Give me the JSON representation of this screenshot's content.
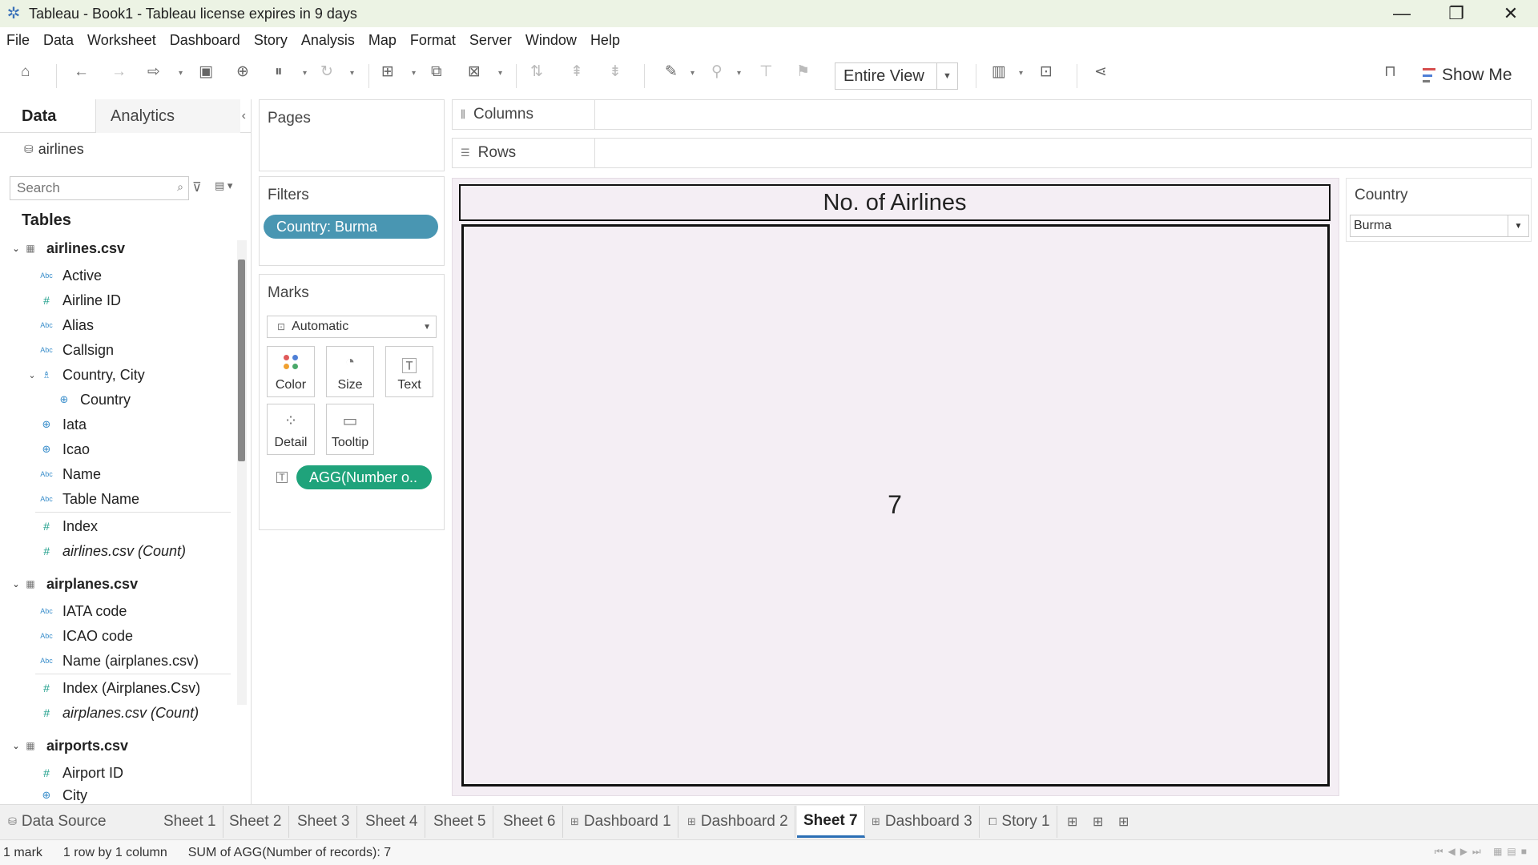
{
  "window": {
    "title": "Tableau - Book1 - Tableau license expires in 9 days",
    "controls": [
      "—",
      "❐",
      "✕"
    ]
  },
  "menu": [
    "File",
    "Data",
    "Worksheet",
    "Dashboard",
    "Story",
    "Analysis",
    "Map",
    "Format",
    "Server",
    "Window",
    "Help"
  ],
  "toolbar": {
    "view_mode": "Entire View",
    "show_me": "Show Me"
  },
  "datapane": {
    "tab_data": "Data",
    "tab_analytics": "Analytics",
    "datasource": "airlines",
    "search_placeholder": "Search",
    "tables_header": "Tables",
    "rows": [
      {
        "kind": "table",
        "label": "airlines.csv"
      },
      {
        "kind": "abc",
        "label": "Active"
      },
      {
        "kind": "num",
        "label": "Airline ID"
      },
      {
        "kind": "abc",
        "label": "Alias"
      },
      {
        "kind": "abc",
        "label": "Callsign"
      },
      {
        "kind": "hier",
        "label": "Country, City"
      },
      {
        "kind": "geo",
        "label": "Country"
      },
      {
        "kind": "geo",
        "label": "Iata"
      },
      {
        "kind": "geo",
        "label": "Icao"
      },
      {
        "kind": "abc",
        "label": "Name"
      },
      {
        "kind": "abc",
        "label": "Table Name"
      },
      {
        "kind": "num",
        "label": "Index"
      },
      {
        "kind": "num",
        "label": "airlines.csv (Count)"
      },
      {
        "kind": "table",
        "label": "airplanes.csv"
      },
      {
        "kind": "abc",
        "label": "IATA code"
      },
      {
        "kind": "abc",
        "label": "ICAO code"
      },
      {
        "kind": "abc",
        "label": "Name (airplanes.csv)"
      },
      {
        "kind": "num",
        "label": "Index (Airplanes.Csv)"
      },
      {
        "kind": "num",
        "label": "airplanes.csv (Count)"
      },
      {
        "kind": "table",
        "label": "airports.csv"
      },
      {
        "kind": "num",
        "label": "Airport ID"
      },
      {
        "kind": "geo",
        "label": "City"
      }
    ]
  },
  "cards": {
    "pages": "Pages",
    "filters": "Filters",
    "filter_pill": "Country: Burma",
    "marks": "Marks",
    "mark_type": "Automatic",
    "mark_buttons": [
      "Color",
      "Size",
      "Text",
      "Detail",
      "Tooltip"
    ],
    "text_pill": "AGG(Number o.."
  },
  "shelves": {
    "columns": "Columns",
    "rows": "Rows"
  },
  "viz": {
    "title": "No. of Airlines",
    "value": "7"
  },
  "country_filter": {
    "title": "Country",
    "selected": "Burma"
  },
  "tabs": [
    "Data Source",
    "Sheet 1",
    "Sheet 2",
    "Sheet 3",
    "Sheet 4",
    "Sheet 5",
    "Sheet 6",
    "Dashboard 1",
    "Dashboard 2",
    "Sheet 7",
    "Dashboard 3",
    "Story 1"
  ],
  "active_tab": "Sheet 7",
  "status": {
    "marks": "1 mark",
    "dims": "1 row by 1 column",
    "sum": "SUM of AGG(Number of records): 7"
  },
  "colors": {
    "filter_pill": "#4996b2",
    "measure_pill": "#1fa37b",
    "view_bg": "#f4eef4"
  }
}
